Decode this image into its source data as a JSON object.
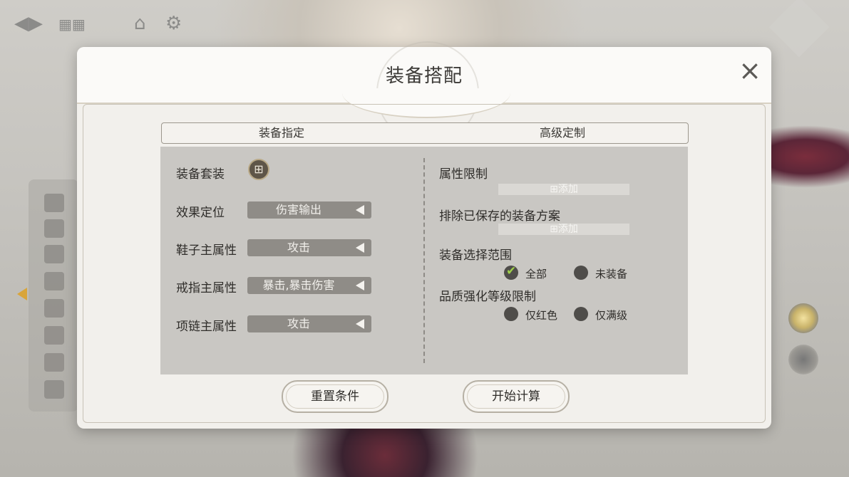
{
  "dialog": {
    "title": "装备搭配",
    "close_icon": "×"
  },
  "tabs": {
    "equip_assign": "装备指定",
    "advanced": "高级定制"
  },
  "left": {
    "equip_set_label": "装备套装",
    "add_set_icon": "⊞",
    "effect_label": "效果定位",
    "effect_value": "伤害输出",
    "shoes_label": "鞋子主属性",
    "shoes_value": "攻击",
    "ring_label": "戒指主属性",
    "ring_value": "暴击,暴击伤害",
    "necklace_label": "项链主属性",
    "necklace_value": "攻击"
  },
  "right": {
    "attr_limit_label": "属性限制",
    "attr_add": "⊞添加",
    "exclude_label": "排除已保存的装备方案",
    "exclude_add": "⊞添加",
    "range_label": "装备选择范围",
    "range_options": [
      "全部",
      "未装备"
    ],
    "range_selected": "全部",
    "quality_label": "品质强化等级限制",
    "quality_options": [
      "仅红色",
      "仅满级"
    ]
  },
  "buttons": {
    "reset": "重置条件",
    "start": "开始计算"
  },
  "colors": {
    "accent_check": "#9fd04a",
    "side_arrow": "#d9a53a"
  }
}
